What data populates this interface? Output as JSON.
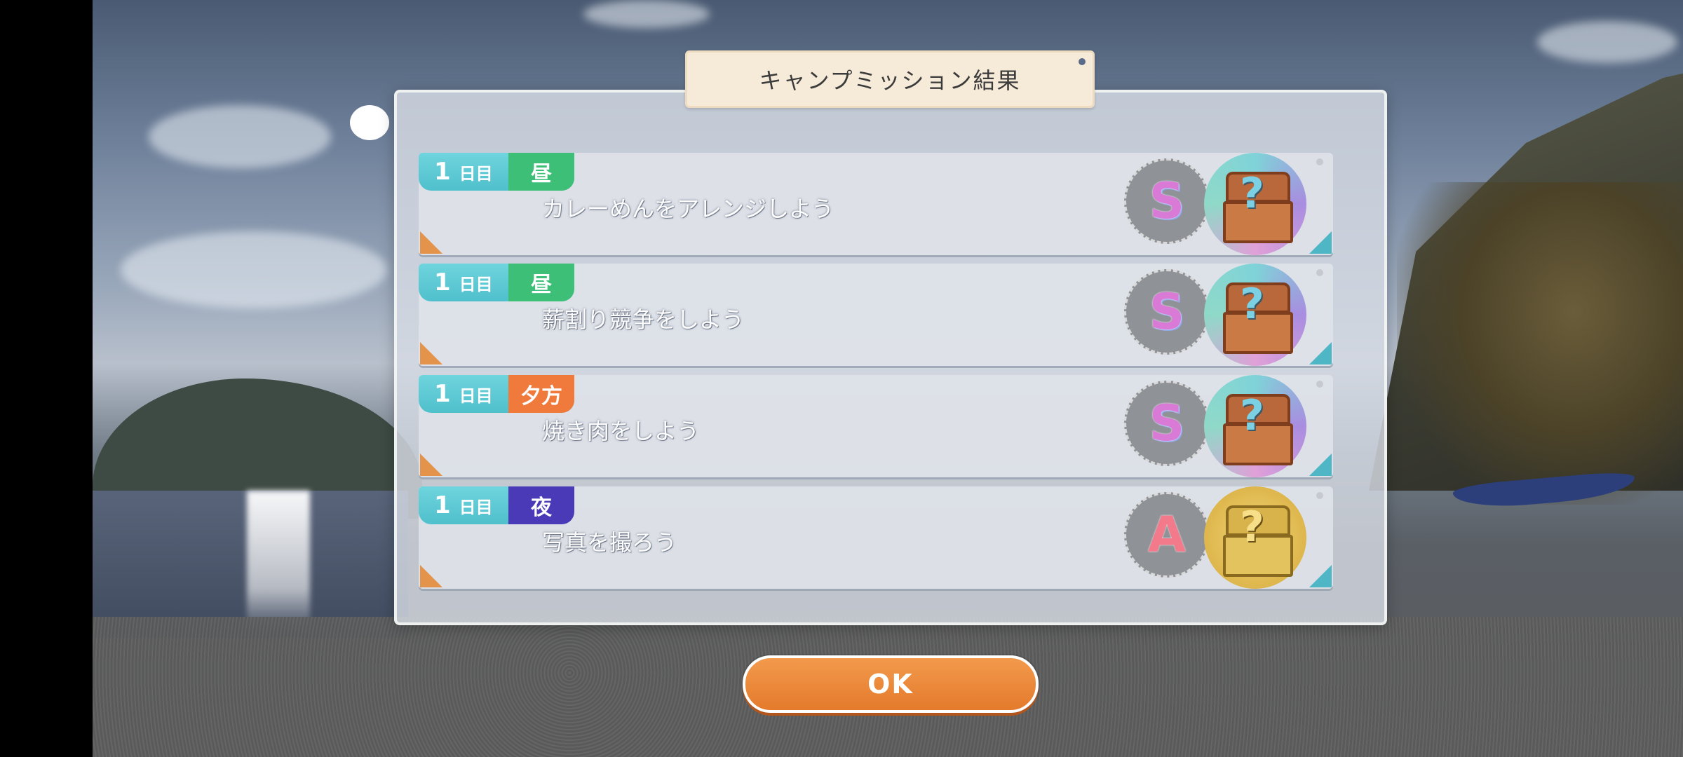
{
  "dialog": {
    "title": "キャンプミッション結果"
  },
  "missions": [
    {
      "day": "1",
      "day_suffix": "日目",
      "time": "昼",
      "time_color": "#3dbf78",
      "text": "カレーめんをアレンジしよう",
      "rank": "S",
      "reward": "rainbow-chest-icon"
    },
    {
      "day": "1",
      "day_suffix": "日目",
      "time": "昼",
      "time_color": "#3dbf78",
      "text": "薪割り競争をしよう",
      "rank": "S",
      "reward": "rainbow-chest-icon"
    },
    {
      "day": "1",
      "day_suffix": "日目",
      "time": "夕方",
      "time_color": "#ef7a3c",
      "text": "焼き肉をしよう",
      "rank": "S",
      "reward": "rainbow-chest-icon"
    },
    {
      "day": "1",
      "day_suffix": "日目",
      "time": "夜",
      "time_color": "#4a3ab8",
      "text": "写真を撮ろう",
      "rank": "A",
      "reward": "gold-chest-icon"
    }
  ],
  "ok_button": {
    "label": "OK"
  },
  "colors": {
    "accent": "#e47a2c",
    "tag_cyan": "#4fc0cc"
  }
}
